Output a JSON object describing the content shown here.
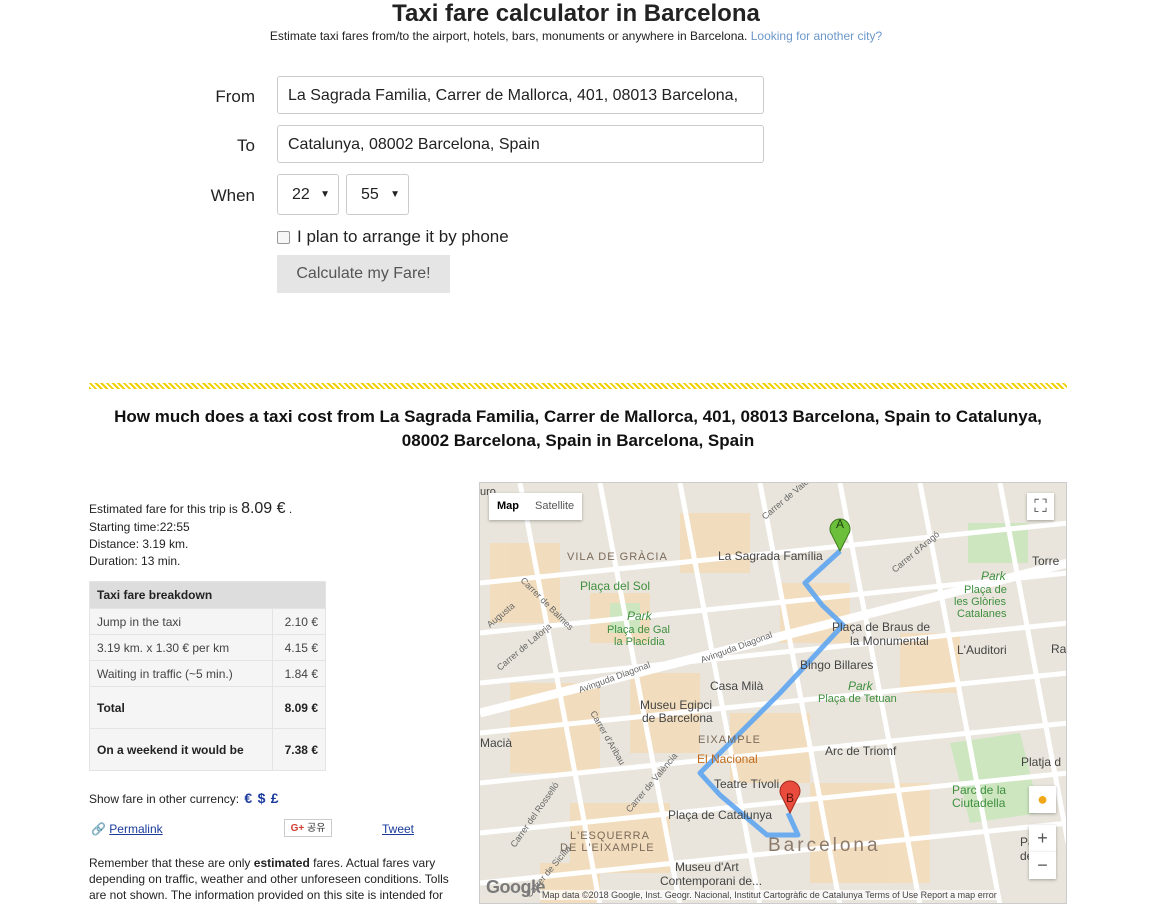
{
  "header": {
    "title": "Taxi fare calculator in Barcelona",
    "subtitle": "Estimate taxi fares from/to the airport, hotels, bars, monuments or anywhere in Barcelona.",
    "subtitle_link": "Looking for another city?"
  },
  "form": {
    "from_label": "From",
    "from_value": "La Sagrada Familia, Carrer de Mallorca, 401, 08013 Barcelona,",
    "to_label": "To",
    "to_value": "Catalunya, 08002 Barcelona, Spain",
    "when_label": "When",
    "hour": "22",
    "minute": "55",
    "phone_checkbox_label": "I plan to arrange it by phone",
    "calculate_label": "Calculate my Fare!"
  },
  "result": {
    "title": "How much does a taxi cost from La Sagrada Familia, Carrer de Mallorca, 401, 08013 Barcelona, Spain to Catalunya, 08002 Barcelona, Spain in Barcelona, Spain",
    "fare_prefix": "Estimated fare for this trip is",
    "fare_value": "8.09 €",
    "fare_suffix": ".",
    "start_time": "Starting time:22:55",
    "distance": "Distance: 3.19 km.",
    "duration": "Duration: 13 min."
  },
  "breakdown": {
    "header": "Taxi fare breakdown",
    "rows": [
      {
        "label": "Jump in the taxi",
        "value": "2.10 €"
      },
      {
        "label": "3.19 km. x 1.30 € per km",
        "value": "4.15 €"
      },
      {
        "label": "Waiting in traffic (~5 min.)",
        "value": "1.84 €"
      },
      {
        "label": "Total",
        "value": "8.09 €"
      },
      {
        "label": "On a weekend it would be",
        "value": "7.38 €"
      }
    ]
  },
  "currency": {
    "label": "Show fare in other currency:",
    "options": [
      "€",
      "$",
      "£"
    ]
  },
  "share": {
    "permalink": "Permalink",
    "google_share": "공유",
    "tweet": "Tweet"
  },
  "disclaimer": {
    "before": "Remember that these are only",
    "bold": "estimated",
    "after": "fares. Actual fares vary depending on traffic, weather and other unforeseen conditions. Tolls are not shown. The information provided on this site is intended for"
  },
  "map": {
    "tab_map": "Map",
    "tab_satellite": "Satellite",
    "attribution": "Map data ©2018 Google, Inst. Geogr. Nacional, Institut Cartogràfic de Catalunya  Terms of Use  Report a map error",
    "logo": "Google",
    "marker_a": "A",
    "marker_b": "B",
    "labels": {
      "vila_gracia": "VILA DE GRÀCIA",
      "sagrada": "La Sagrada Família",
      "placa_sol": "Plaça del Sol",
      "park1": "Park",
      "placa_gal1": "Plaça de Gal",
      "placa_gal2": "la Placídia",
      "braus1": "Plaça de Braus de",
      "braus2": "la Monumental",
      "bingo": "Bingo Billares",
      "casa_mila": "Casa Milà",
      "museu_egipci1": "Museu Egipci",
      "museu_egipci2": "de Barcelona",
      "park2": "Park",
      "tetuan": "Plaça de Tetuan",
      "eixample": "EIXAMPLE",
      "nacional": "El Nacional",
      "arc": "Arc de Triomf",
      "teatre": "Teatre Tívoli",
      "placa_cat": "Plaça de Catalunya",
      "esquerra1": "L'ESQUERRA",
      "esquerra2": "DE L'EIXAMPLE",
      "barcelona": "Barcelona",
      "museu_art1": "Museu d'Art",
      "museu_art2": "Contemporani de...",
      "parc_ciutadella1": "Parc de la",
      "parc_ciutadella2": "Ciutadella",
      "auditori": "L'Auditori",
      "park3": "Park",
      "glories1": "Plaça de",
      "glories2": "les Glòries",
      "glories3": "Catalanes",
      "torre": "Torre",
      "macia": "Macià",
      "platja": "Platja d",
      "ra": "Ra",
      "pa": "Pa",
      "de": "de",
      "uro": "uro",
      "st_valencia1": "Carrer de València",
      "st_arago": "Carrer d'Aragó",
      "st_diagonal1": "Avinguda Diagonal",
      "st_diagonal2": "Avinguda Diagonal",
      "st_diagonal3": "Avinguda Diagonal",
      "st_balmes": "Carrer de Balmes",
      "st_laforja": "Carrer de Laforja",
      "st_aribau": "Carrer d'Aribau",
      "st_valencia2": "Carrer de València",
      "st_rossello": "Carrer del Rosselló",
      "st_sicilia": "Carrer de Sicília",
      "st_augusta": "Augusta"
    }
  }
}
